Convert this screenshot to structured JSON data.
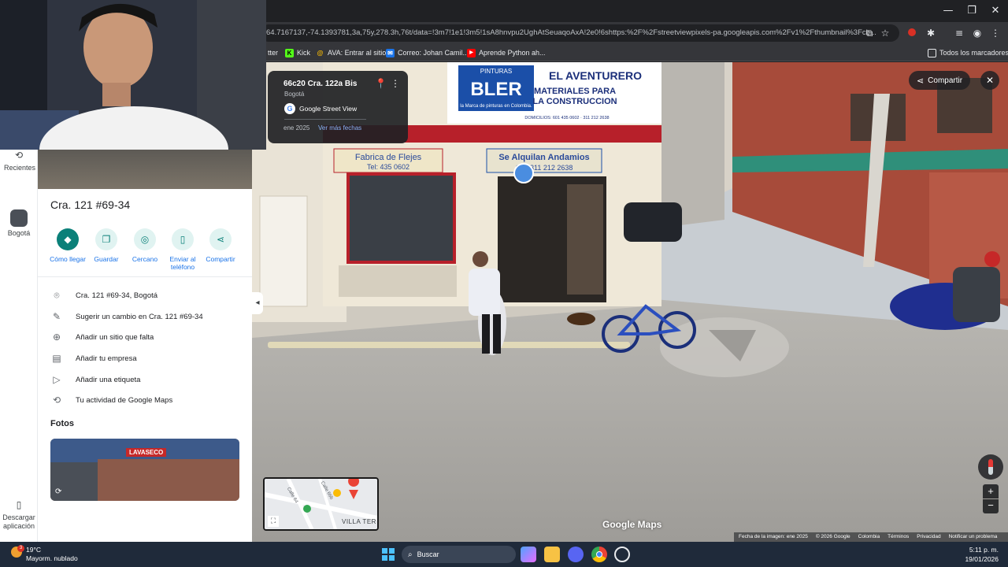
{
  "browser": {
    "url": "64.7167137,-74.1393781,3a,75y,278.3h,76t/data=!3m7!1e1!3m5!1sA8hnvpu2UghAtSeuaqoAxA!2e0!6shttps:%2F%2Fstreetviewpixels-pa.googleapis.com%2Fv1%2Fthumbnail%3Fcb...",
    "bookmarks": [
      {
        "label": "tter",
        "icon": "twitter-icon"
      },
      {
        "label": "Kick",
        "icon": "kick-icon"
      },
      {
        "label": "AVA: Entrar al sitio",
        "icon": "at-icon"
      },
      {
        "label": "Correo: Johan Camil...",
        "icon": "mail-icon"
      },
      {
        "label": "Aprende Python ah...",
        "icon": "youtube-icon"
      }
    ],
    "all_bookmarks": "Todos los marcadores"
  },
  "street_view": {
    "address": "66c20 Cra. 122a Bis",
    "city": "Bogotá",
    "source": "Google Street View",
    "date": "ene 2025",
    "more_dates": "Ver más fechas",
    "share": "Compartir",
    "watermark": "Google Maps",
    "footer": {
      "image_date": "Fecha de la imagen: ene 2025",
      "copyright": "© 2026 Google",
      "country": "Colombia",
      "terms": "Términos",
      "privacy": "Privacidad",
      "report": "Notificar un problema"
    },
    "signs": {
      "bler_top": "PINTURAS",
      "bler": "BLER",
      "bler_sub": "la Marca de pinturas en Colombia.",
      "aventurero": "EL AVENTURERO",
      "materiales": "MATERIALES PARA",
      "construccion": "LA CONSTRUCCION",
      "domicilios": "DOMICILIOS: 601 435 0602 · 311 212 2638",
      "flejes": "Fabrica de Flejes",
      "flejes_tel": "Tel: 435 0602",
      "andamios": "Se Alquilan Andamios",
      "andamios_tel": "Cel: 311 212 2638"
    },
    "minimap": {
      "street1": "Calle 64",
      "street2": "Calle 66b",
      "area": "VILLA TER"
    }
  },
  "rail": {
    "recent_label": "Recientes",
    "bogota_label": "Bogotá",
    "download_label": "Descargar aplicación"
  },
  "panel": {
    "title": "Cra. 121 #69-34",
    "actions": [
      {
        "label": "Cómo llegar",
        "icon": "directions-icon"
      },
      {
        "label": "Guardar",
        "icon": "bookmark-icon"
      },
      {
        "label": "Cercano",
        "icon": "nearby-icon"
      },
      {
        "label": "Enviar al teléfono",
        "icon": "send-to-phone-icon"
      },
      {
        "label": "Compartir",
        "icon": "share-icon"
      }
    ],
    "rows": [
      {
        "text": "Cra. 121 #69-34, Bogotá",
        "icon": "location-pin-icon"
      },
      {
        "text": "Sugerir un cambio en Cra. 121 #69-34",
        "icon": "pencil-icon"
      },
      {
        "text": "Añadir un sitio que falta",
        "icon": "add-place-icon"
      },
      {
        "text": "Añadir tu empresa",
        "icon": "store-icon"
      },
      {
        "text": "Añadir una etiqueta",
        "icon": "label-icon"
      },
      {
        "text": "Tu actividad de Google Maps",
        "icon": "history-icon"
      }
    ],
    "photos_heading": "Fotos",
    "photo_sign": "LAVASECO"
  },
  "taskbar": {
    "weather_temp": "19°C",
    "weather_desc": "Mayorm. nublado",
    "weather_badge": "3",
    "search": "Buscar",
    "time": "5:11 p. m.",
    "date": "19/01/2026"
  }
}
